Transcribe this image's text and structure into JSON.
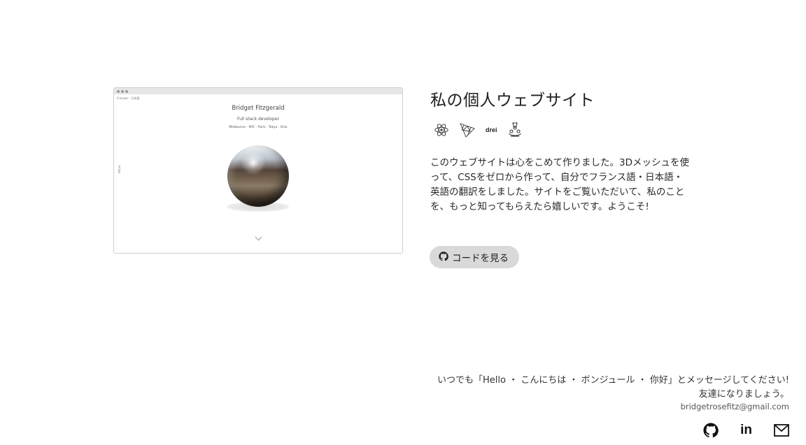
{
  "preview": {
    "lang": "Français · 日本語",
    "name": "Bridget Fitzgerald",
    "role": "Full stack developer",
    "cities": "Melbourne · NYC · Paris · Tokyo · Oslo",
    "side_label": "About"
  },
  "project": {
    "title": "私の個人ウェブサイト",
    "tech_icons": [
      "react-icon",
      "threejs-icon",
      "drei-icon",
      "jest-icon"
    ],
    "drei_label": "drei",
    "description": "このウェブサイトは心をこめて作りました。3Dメッシュを使って、CSSをゼロから作って、自分でフランス語・日本語・英語の翻訳をしました。サイトをご覧いただいて、私のことを、もっと知ってもらえたら嬉しいです。ようこそ!",
    "code_button": "コードを見る"
  },
  "footer": {
    "message_line1": "いつでも「Hello ・ こんにちは ・ ボンジュール ・ 你好」とメッセージしてください!",
    "message_line2": "友達になりましょう。",
    "email": "bridgetrosefitz@gmail.com",
    "linkedin_label": "in",
    "icons": [
      "github-icon",
      "linkedin-icon",
      "mail-icon"
    ]
  }
}
